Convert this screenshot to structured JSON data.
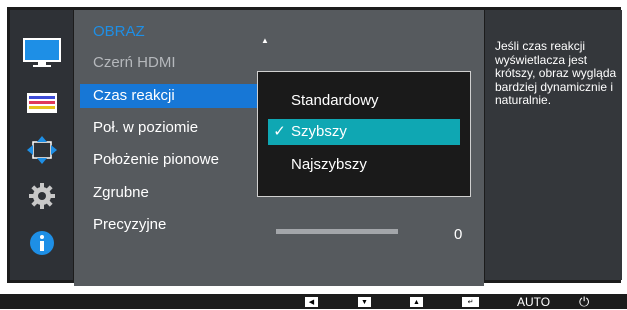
{
  "menu": {
    "category": "OBRAZ",
    "items": [
      {
        "label": "Czerń HDMI"
      },
      {
        "label": "Czas reakcji"
      },
      {
        "label": "Poł. w poziomie"
      },
      {
        "label": "Położenie pionowe"
      },
      {
        "label": "Zgrubne"
      },
      {
        "label": "Precyzyjne"
      }
    ],
    "selected_index": 1
  },
  "dropdown": {
    "options": [
      {
        "label": "Standardowy"
      },
      {
        "label": "Szybszy"
      },
      {
        "label": "Najszybszy"
      }
    ],
    "selected_index": 1
  },
  "precyzyjne_value": "0",
  "info": {
    "text": "Jeśli czas reakcji wyświetlacza jest krótszy, obraz wygląda bardziej dynamicznie i naturalnie."
  },
  "sidebar": {
    "icons": [
      "monitor-icon",
      "color-bars-icon",
      "resize-arrows-icon",
      "gear-icon",
      "info-icon"
    ]
  },
  "bottom_bar": {
    "auto_label": "AUTO"
  },
  "colors": {
    "accent_blue": "#1777d6",
    "category_blue": "#1e8fe6",
    "selection_teal": "#0fa7b3",
    "panel_gray": "#565a5e"
  }
}
